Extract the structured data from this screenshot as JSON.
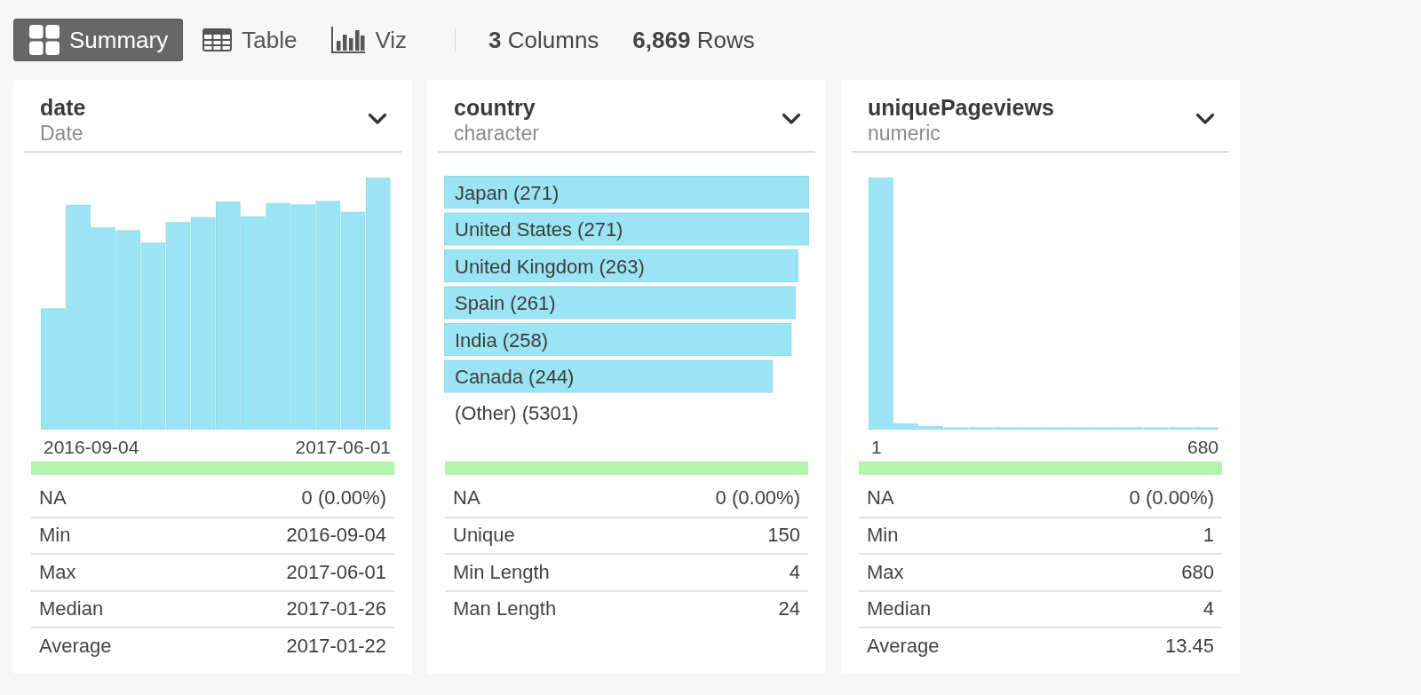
{
  "toolbar": {
    "tabs": [
      {
        "label": "Summary",
        "selected": true
      },
      {
        "label": "Table",
        "selected": false
      },
      {
        "label": "Viz",
        "selected": false
      }
    ],
    "counts": [
      {
        "text": "**3** Columns"
      },
      {
        "text": "**6,869** Rows"
      }
    ]
  },
  "columns": [
    {
      "kind": "histogram",
      "name": "date",
      "type": "Date",
      "axis_labels": [
        "2016-09-04",
        "2017-06-01"
      ],
      "quality_bar": {
        "level": 1
      },
      "stats": [
        {
          "label": "NA",
          "value": "0 (0.00%)"
        },
        {
          "label": "Min",
          "value": "2016-09-04"
        },
        {
          "label": "Max",
          "value": "2017-06-01"
        },
        {
          "label": "Median",
          "value": "2017-01-26"
        },
        {
          "label": "Average",
          "value": "2017-01-22"
        }
      ]
    },
    {
      "kind": "top_values",
      "name": "country",
      "type": "character",
      "chart_data": {
        "type": "bar",
        "orientation": "horizontal",
        "categories": [
          "Japan",
          "United States",
          "United Kingdom",
          "Spain",
          "India",
          "Canada"
        ],
        "values": [
          271,
          271,
          263,
          261,
          258,
          244
        ],
        "value_labels": [
          "(271)",
          "(271)",
          "(263)",
          "(261)",
          "(258)",
          "(244)"
        ]
      },
      "other": {
        "label": "(Other) (5301)"
      },
      "quality_bar": {
        "level": 1
      },
      "stats": [
        {
          "label": "NA",
          "value": "0 (0.00%)"
        },
        {
          "label": "Unique",
          "value": "150"
        },
        {
          "label": "Min Length",
          "value": "4"
        },
        {
          "label": "Man Length",
          "value": "24"
        }
      ]
    },
    {
      "kind": "histogram",
      "name": "uniquePageviews",
      "type": "numeric",
      "axis_labels": [
        "1",
        "680"
      ],
      "quality_bar": {
        "level": 1
      },
      "stats": [
        {
          "label": "NA",
          "value": "0 (0.00%)"
        },
        {
          "label": "Min",
          "value": "1"
        },
        {
          "label": "Max",
          "value": "680"
        },
        {
          "label": "Median",
          "value": "4"
        },
        {
          "label": "Average",
          "value": "13.45"
        }
      ]
    }
  ]
}
